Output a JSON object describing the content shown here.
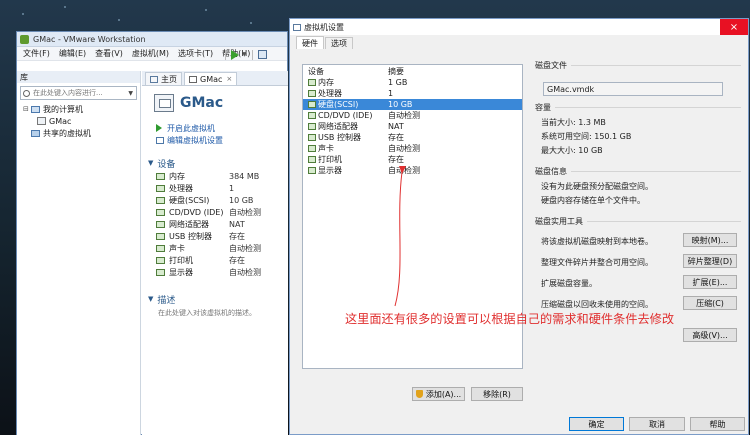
{
  "colors": {
    "accent": "#3a88d8",
    "annotation": "#e03030",
    "link": "#1f5aa8"
  },
  "main_window": {
    "title": "GMac - VMware Workstation",
    "menu": [
      "文件(F)",
      "编辑(E)",
      "查看(V)",
      "虚拟机(M)",
      "选项卡(T)",
      "帮助(H)"
    ],
    "library": {
      "header": "库",
      "search_placeholder": "在此处键入内容进行...",
      "tree": [
        {
          "label": "我的计算机",
          "toggle": "⊟"
        },
        {
          "label": "GMac"
        },
        {
          "label": "共享的虚拟机"
        }
      ]
    },
    "tabs": [
      {
        "label": "主页"
      },
      {
        "label": "GMac",
        "close": "×"
      }
    ],
    "vm_title": "GMac",
    "actions": {
      "power_on": "开启此虚拟机",
      "edit_settings": "编辑虚拟机设置"
    },
    "devices_section": "设备",
    "devices": [
      {
        "name": "内存",
        "value": "384 MB"
      },
      {
        "name": "处理器",
        "value": "1"
      },
      {
        "name": "硬盘(SCSI)",
        "value": "10 GB"
      },
      {
        "name": "CD/DVD (IDE)",
        "value": "自动检测"
      },
      {
        "name": "网络适配器",
        "value": "NAT"
      },
      {
        "name": "USB 控制器",
        "value": "存在"
      },
      {
        "name": "声卡",
        "value": "自动检测"
      },
      {
        "name": "打印机",
        "value": "存在"
      },
      {
        "name": "显示器",
        "value": "自动检测"
      }
    ],
    "description_section": "描述",
    "description_hint": "在此处键入对该虚拟机的描述。"
  },
  "dialog": {
    "title": "虚拟机设置",
    "close_glyph": "×",
    "tabs": [
      "硬件",
      "选项"
    ],
    "hw_header": {
      "device": "设备",
      "summary": "摘要"
    },
    "hardware": [
      {
        "device": "内存",
        "summary": "1 GB"
      },
      {
        "device": "处理器",
        "summary": "1"
      },
      {
        "device": "硬盘(SCSI)",
        "summary": "10 GB",
        "selected": true
      },
      {
        "device": "CD/DVD (IDE)",
        "summary": "自动检测"
      },
      {
        "device": "网络适配器",
        "summary": "NAT"
      },
      {
        "device": "USB 控制器",
        "summary": "存在"
      },
      {
        "device": "声卡",
        "summary": "自动检测"
      },
      {
        "device": "打印机",
        "summary": "存在"
      },
      {
        "device": "显示器",
        "summary": "自动检测"
      }
    ],
    "add_button": "添加(A)...",
    "remove_button": "移除(R)",
    "disk_file": {
      "title": "磁盘文件",
      "value": "GMac.vmdk"
    },
    "capacity": {
      "title": "容量",
      "current": "当前大小: 1.3 MB",
      "free": "系统可用空间: 150.1 GB",
      "max": "最大大小: 10 GB"
    },
    "disk_info": {
      "title": "磁盘信息",
      "line1": "没有为此硬盘预分配磁盘空间。",
      "line2": "硬盘内容存储在单个文件中。"
    },
    "utilities": {
      "title": "磁盘实用工具",
      "rows": [
        {
          "text": "将该虚拟机磁盘映射到本地卷。",
          "button": "映射(M)..."
        },
        {
          "text": "整理文件碎片并整合可用空间。",
          "button": "碎片整理(D)"
        },
        {
          "text": "扩展磁盘容量。",
          "button": "扩展(E)..."
        },
        {
          "text": "压缩磁盘以回收未使用的空间。",
          "button": "压缩(C)"
        }
      ],
      "advanced_button": "高级(V)..."
    },
    "ok_button": "确定",
    "cancel_button": "取消",
    "help_button": "帮助"
  },
  "annotation": "这里面还有很多的设置可以根据自己的需求和硬件条件去修改"
}
